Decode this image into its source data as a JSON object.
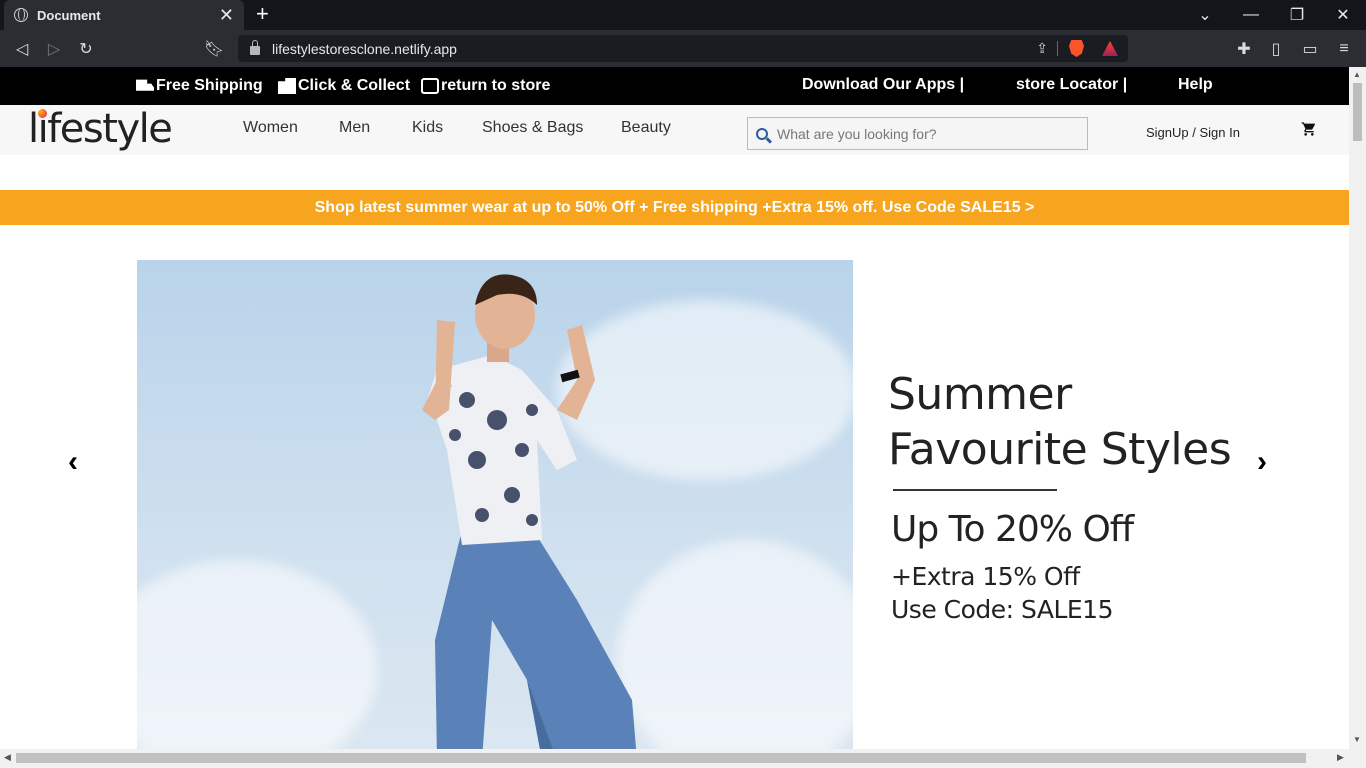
{
  "browser": {
    "tab_title": "Document",
    "url": "lifestylestoresclone.netlify.app"
  },
  "topstrip": {
    "free_shipping": "Free Shipping",
    "click_collect": "Click & Collect",
    "return_store": "return to store",
    "download_apps": "Download Our Apps |",
    "store_locator": "store Locator |",
    "help": "Help"
  },
  "header": {
    "logo": "lifestyle",
    "nav": [
      "Women",
      "Men",
      "Kids",
      "Shoes & Bags",
      "Beauty"
    ],
    "search_placeholder": "What are you looking for?",
    "signin": "SignUp / Sign In"
  },
  "banner": {
    "text": "Shop latest summer wear at up to 50% Off + Free shipping +Extra 15% off. Use Code SALE15 >"
  },
  "hero": {
    "line1": "Summer",
    "line2": "Favourite Styles",
    "discount": "Up To 20% Off",
    "extra": "+Extra 15% Off",
    "code": "Use Code: SALE15",
    "prev": "‹",
    "next": "›"
  },
  "colors": {
    "banner": "#f7a51e",
    "topstrip": "#000000",
    "search_icon": "#2b5e9b"
  }
}
